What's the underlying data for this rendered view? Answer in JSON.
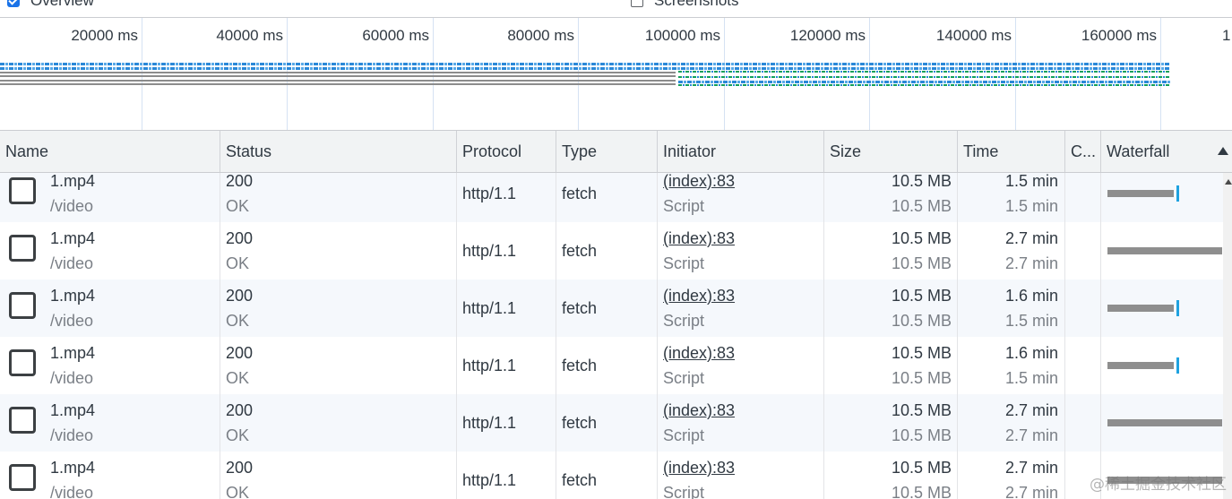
{
  "options": {
    "overview": {
      "label": "Overview",
      "checked": true
    },
    "screenshots": {
      "label": "Screenshots",
      "checked": false
    }
  },
  "timeline": {
    "ticks": [
      "20000 ms",
      "40000 ms",
      "60000 ms",
      "80000 ms",
      "100000 ms",
      "120000 ms",
      "140000 ms",
      "160000 ms",
      "1"
    ]
  },
  "columns": {
    "name": "Name",
    "status": "Status",
    "protocol": "Protocol",
    "type": "Type",
    "initiator": "Initiator",
    "size": "Size",
    "time": "Time",
    "c": "C...",
    "waterfall": "Waterfall"
  },
  "rows": [
    {
      "name": "1.mp4",
      "path": "/video",
      "status": "200",
      "status_text": "OK",
      "protocol": "http/1.1",
      "type": "fetch",
      "initiator": "(index):83",
      "initiator_type": "Script",
      "size": "10.5 MB",
      "resource_size": "10.5 MB",
      "time": "1.5 min",
      "latency": "1.5 min",
      "waterfall_fraction": 0.58,
      "waterfall_complete": true
    },
    {
      "name": "1.mp4",
      "path": "/video",
      "status": "200",
      "status_text": "OK",
      "protocol": "http/1.1",
      "type": "fetch",
      "initiator": "(index):83",
      "initiator_type": "Script",
      "size": "10.5 MB",
      "resource_size": "10.5 MB",
      "time": "2.7 min",
      "latency": "2.7 min",
      "waterfall_fraction": 1.0,
      "waterfall_complete": false
    },
    {
      "name": "1.mp4",
      "path": "/video",
      "status": "200",
      "status_text": "OK",
      "protocol": "http/1.1",
      "type": "fetch",
      "initiator": "(index):83",
      "initiator_type": "Script",
      "size": "10.5 MB",
      "resource_size": "10.5 MB",
      "time": "1.6 min",
      "latency": "1.5 min",
      "waterfall_fraction": 0.58,
      "waterfall_complete": true
    },
    {
      "name": "1.mp4",
      "path": "/video",
      "status": "200",
      "status_text": "OK",
      "protocol": "http/1.1",
      "type": "fetch",
      "initiator": "(index):83",
      "initiator_type": "Script",
      "size": "10.5 MB",
      "resource_size": "10.5 MB",
      "time": "1.6 min",
      "latency": "1.5 min",
      "waterfall_fraction": 0.58,
      "waterfall_complete": true
    },
    {
      "name": "1.mp4",
      "path": "/video",
      "status": "200",
      "status_text": "OK",
      "protocol": "http/1.1",
      "type": "fetch",
      "initiator": "(index):83",
      "initiator_type": "Script",
      "size": "10.5 MB",
      "resource_size": "10.5 MB",
      "time": "2.7 min",
      "latency": "2.7 min",
      "waterfall_fraction": 1.0,
      "waterfall_complete": false
    },
    {
      "name": "1.mp4",
      "path": "/video",
      "status": "200",
      "status_text": "OK",
      "protocol": "http/1.1",
      "type": "fetch",
      "initiator": "(index):83",
      "initiator_type": "Script",
      "size": "10.5 MB",
      "resource_size": "10.5 MB",
      "time": "2.7 min",
      "latency": "2.7 min",
      "waterfall_fraction": 1.0,
      "waterfall_complete": false
    }
  ],
  "icons": {
    "request": "file-icon",
    "sort": "sort-ascending-icon"
  },
  "colors": {
    "accent": "#1a73e8",
    "waterfall_bar": "#8e8e8e",
    "waterfall_end": "#1fa2e0",
    "overview_green": "#13a05a"
  },
  "watermark": "@稀土掘金技术社区"
}
